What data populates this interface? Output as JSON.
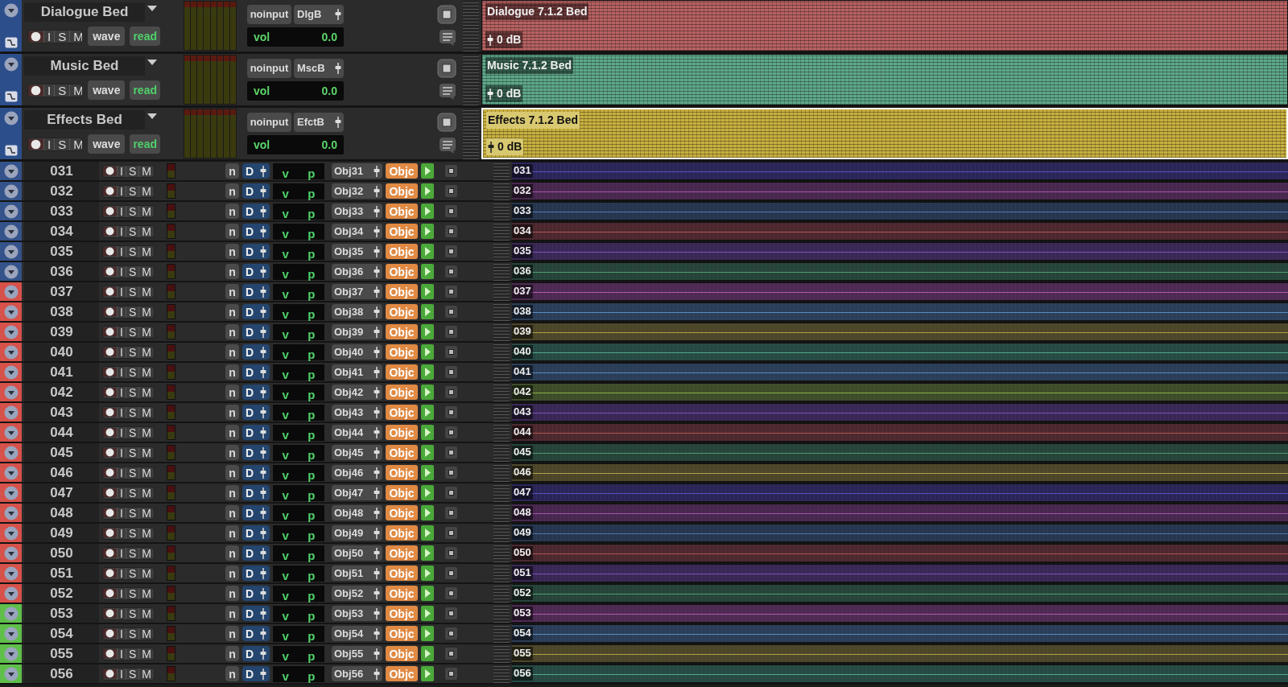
{
  "beds": [
    {
      "name": "Dialogue Bed",
      "color": "#2c4f8c",
      "input_only": "I",
      "solo": "S",
      "mute": "M",
      "view": "wave",
      "automation": "read",
      "input": "noinput",
      "output": "DlgB",
      "volume_label": "vol",
      "volume": "0.0",
      "clip": {
        "name": "Dialogue 7.1.2 Bed",
        "gain": "0 dB",
        "color": "#b86262",
        "selected": false
      }
    },
    {
      "name": "Music Bed",
      "color": "#2c4f8c",
      "input_only": "I",
      "solo": "S",
      "mute": "M",
      "view": "wave",
      "automation": "read",
      "input": "noinput",
      "output": "MscB",
      "volume_label": "vol",
      "volume": "0.0",
      "clip": {
        "name": "Music 7.1.2 Bed",
        "gain": "0 dB",
        "color": "#5fa88a",
        "selected": false
      }
    },
    {
      "name": "Effects Bed",
      "color": "#2c4f8c",
      "input_only": "I",
      "solo": "S",
      "mute": "M",
      "view": "wave",
      "automation": "read",
      "input": "noinput",
      "output": "EfctB",
      "volume_label": "vol",
      "volume": "0.0",
      "clip": {
        "name": "Effects 7.1.2 Bed",
        "gain": "0 dB",
        "color": "#c8b040",
        "selected": true
      }
    }
  ],
  "tracks": [
    {
      "name": "031",
      "color": "#34538a",
      "input_only": "I",
      "solo": "S",
      "mute": "M",
      "input": "n",
      "output_mode": "D",
      "volume_label": "v",
      "pan_label": "p",
      "output": "Obj31",
      "panner": "Objc",
      "clip": {
        "name": "031",
        "color": "#5b4fc0"
      }
    },
    {
      "name": "032",
      "color": "#34538a",
      "input_only": "I",
      "solo": "S",
      "mute": "M",
      "input": "n",
      "output_mode": "D",
      "volume_label": "v",
      "pan_label": "p",
      "output": "Obj32",
      "panner": "Objc",
      "clip": {
        "name": "032",
        "color": "#a552a8"
      }
    },
    {
      "name": "033",
      "color": "#34538a",
      "input_only": "I",
      "solo": "S",
      "mute": "M",
      "input": "n",
      "output_mode": "D",
      "volume_label": "v",
      "pan_label": "p",
      "output": "Obj33",
      "panner": "Objc",
      "clip": {
        "name": "033",
        "color": "#4f78a8"
      }
    },
    {
      "name": "034",
      "color": "#34538a",
      "input_only": "I",
      "solo": "S",
      "mute": "M",
      "input": "n",
      "output_mode": "D",
      "volume_label": "v",
      "pan_label": "p",
      "output": "Obj34",
      "panner": "Objc",
      "clip": {
        "name": "034",
        "color": "#b05454"
      }
    },
    {
      "name": "035",
      "color": "#34538a",
      "input_only": "I",
      "solo": "S",
      "mute": "M",
      "input": "n",
      "output_mode": "D",
      "volume_label": "v",
      "pan_label": "p",
      "output": "Obj35",
      "panner": "Objc",
      "clip": {
        "name": "035",
        "color": "#7f52b8"
      }
    },
    {
      "name": "036",
      "color": "#34538a",
      "input_only": "I",
      "solo": "S",
      "mute": "M",
      "input": "n",
      "output_mode": "D",
      "volume_label": "v",
      "pan_label": "p",
      "output": "Obj36",
      "panner": "Objc",
      "clip": {
        "name": "036",
        "color": "#4f9a70"
      }
    },
    {
      "name": "037",
      "color": "#d6524a",
      "input_only": "I",
      "solo": "S",
      "mute": "M",
      "input": "n",
      "output_mode": "D",
      "volume_label": "v",
      "pan_label": "p",
      "output": "Obj37",
      "panner": "Objc",
      "clip": {
        "name": "037",
        "color": "#b458b0"
      }
    },
    {
      "name": "038",
      "color": "#d6524a",
      "input_only": "I",
      "solo": "S",
      "mute": "M",
      "input": "n",
      "output_mode": "D",
      "volume_label": "v",
      "pan_label": "p",
      "output": "Obj38",
      "panner": "Objc",
      "clip": {
        "name": "038",
        "color": "#5a8cc0"
      }
    },
    {
      "name": "039",
      "color": "#d6524a",
      "input_only": "I",
      "solo": "S",
      "mute": "M",
      "input": "n",
      "output_mode": "D",
      "volume_label": "v",
      "pan_label": "p",
      "output": "Obj39",
      "panner": "Objc",
      "clip": {
        "name": "039",
        "color": "#b0a048"
      }
    },
    {
      "name": "040",
      "color": "#d6524a",
      "input_only": "I",
      "solo": "S",
      "mute": "M",
      "input": "n",
      "output_mode": "D",
      "volume_label": "v",
      "pan_label": "p",
      "output": "Obj40",
      "panner": "Objc",
      "clip": {
        "name": "040",
        "color": "#50a88a"
      }
    },
    {
      "name": "041",
      "color": "#d6524a",
      "input_only": "I",
      "solo": "S",
      "mute": "M",
      "input": "n",
      "output_mode": "D",
      "volume_label": "v",
      "pan_label": "p",
      "output": "Obj41",
      "panner": "Objc",
      "clip": {
        "name": "041",
        "color": "#5a8cc0"
      }
    },
    {
      "name": "042",
      "color": "#d6524a",
      "input_only": "I",
      "solo": "S",
      "mute": "M",
      "input": "n",
      "output_mode": "D",
      "volume_label": "v",
      "pan_label": "p",
      "output": "Obj42",
      "panner": "Objc",
      "clip": {
        "name": "042",
        "color": "#8ab048"
      }
    },
    {
      "name": "043",
      "color": "#d6524a",
      "input_only": "I",
      "solo": "S",
      "mute": "M",
      "input": "n",
      "output_mode": "D",
      "volume_label": "v",
      "pan_label": "p",
      "output": "Obj43",
      "panner": "Objc",
      "clip": {
        "name": "043",
        "color": "#7f52b8"
      }
    },
    {
      "name": "044",
      "color": "#d6524a",
      "input_only": "I",
      "solo": "S",
      "mute": "M",
      "input": "n",
      "output_mode": "D",
      "volume_label": "v",
      "pan_label": "p",
      "output": "Obj44",
      "panner": "Objc",
      "clip": {
        "name": "044",
        "color": "#b05454"
      }
    },
    {
      "name": "045",
      "color": "#d6524a",
      "input_only": "I",
      "solo": "S",
      "mute": "M",
      "input": "n",
      "output_mode": "D",
      "volume_label": "v",
      "pan_label": "p",
      "output": "Obj45",
      "panner": "Objc",
      "clip": {
        "name": "045",
        "color": "#4f9a70"
      }
    },
    {
      "name": "046",
      "color": "#d6524a",
      "input_only": "I",
      "solo": "S",
      "mute": "M",
      "input": "n",
      "output_mode": "D",
      "volume_label": "v",
      "pan_label": "p",
      "output": "Obj46",
      "panner": "Objc",
      "clip": {
        "name": "046",
        "color": "#b0a048"
      }
    },
    {
      "name": "047",
      "color": "#d6524a",
      "input_only": "I",
      "solo": "S",
      "mute": "M",
      "input": "n",
      "output_mode": "D",
      "volume_label": "v",
      "pan_label": "p",
      "output": "Obj47",
      "panner": "Objc",
      "clip": {
        "name": "047",
        "color": "#5b4fc0"
      }
    },
    {
      "name": "048",
      "color": "#d6524a",
      "input_only": "I",
      "solo": "S",
      "mute": "M",
      "input": "n",
      "output_mode": "D",
      "volume_label": "v",
      "pan_label": "p",
      "output": "Obj48",
      "panner": "Objc",
      "clip": {
        "name": "048",
        "color": "#a552a8"
      }
    },
    {
      "name": "049",
      "color": "#d6524a",
      "input_only": "I",
      "solo": "S",
      "mute": "M",
      "input": "n",
      "output_mode": "D",
      "volume_label": "v",
      "pan_label": "p",
      "output": "Obj49",
      "panner": "Objc",
      "clip": {
        "name": "049",
        "color": "#4f78a8"
      }
    },
    {
      "name": "050",
      "color": "#d6524a",
      "input_only": "I",
      "solo": "S",
      "mute": "M",
      "input": "n",
      "output_mode": "D",
      "volume_label": "v",
      "pan_label": "p",
      "output": "Obj50",
      "panner": "Objc",
      "clip": {
        "name": "050",
        "color": "#b05454"
      }
    },
    {
      "name": "051",
      "color": "#d6524a",
      "input_only": "I",
      "solo": "S",
      "mute": "M",
      "input": "n",
      "output_mode": "D",
      "volume_label": "v",
      "pan_label": "p",
      "output": "Obj51",
      "panner": "Objc",
      "clip": {
        "name": "051",
        "color": "#7f52b8"
      }
    },
    {
      "name": "052",
      "color": "#d6524a",
      "input_only": "I",
      "solo": "S",
      "mute": "M",
      "input": "n",
      "output_mode": "D",
      "volume_label": "v",
      "pan_label": "p",
      "output": "Obj52",
      "panner": "Objc",
      "clip": {
        "name": "052",
        "color": "#4f9a70"
      }
    },
    {
      "name": "053",
      "color": "#5fbf4a",
      "input_only": "I",
      "solo": "S",
      "mute": "M",
      "input": "n",
      "output_mode": "D",
      "volume_label": "v",
      "pan_label": "p",
      "output": "Obj53",
      "panner": "Objc",
      "clip": {
        "name": "053",
        "color": "#b458b0"
      }
    },
    {
      "name": "054",
      "color": "#5fbf4a",
      "input_only": "I",
      "solo": "S",
      "mute": "M",
      "input": "n",
      "output_mode": "D",
      "volume_label": "v",
      "pan_label": "p",
      "output": "Obj54",
      "panner": "Objc",
      "clip": {
        "name": "054",
        "color": "#5a8cc0"
      }
    },
    {
      "name": "055",
      "color": "#5fbf4a",
      "input_only": "I",
      "solo": "S",
      "mute": "M",
      "input": "n",
      "output_mode": "D",
      "volume_label": "v",
      "pan_label": "p",
      "output": "Obj55",
      "panner": "Objc",
      "clip": {
        "name": "055",
        "color": "#b0a048"
      }
    },
    {
      "name": "056",
      "color": "#5fbf4a",
      "input_only": "I",
      "solo": "S",
      "mute": "M",
      "input": "n",
      "output_mode": "D",
      "volume_label": "v",
      "pan_label": "p",
      "output": "Obj56",
      "panner": "Objc",
      "clip": {
        "name": "056",
        "color": "#50a88a"
      }
    }
  ]
}
